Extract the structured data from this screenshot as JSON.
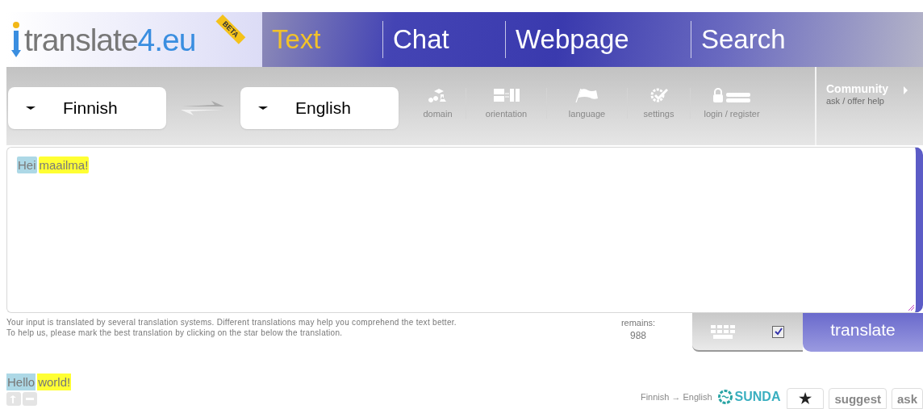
{
  "logo": {
    "parts": [
      "translate",
      "4.eu"
    ],
    "badge": "BETA"
  },
  "tabs": [
    {
      "label": "Text",
      "selected": true
    },
    {
      "label": "Chat",
      "selected": false
    },
    {
      "label": "Webpage",
      "selected": false
    },
    {
      "label": "Search",
      "selected": false
    }
  ],
  "languages": {
    "source": "Finnish",
    "target": "English"
  },
  "tools": [
    {
      "kind": "domain",
      "label": "domain"
    },
    {
      "kind": "orientation",
      "label": "orientation"
    },
    {
      "kind": "language",
      "label": "language"
    },
    {
      "kind": "settings",
      "label": "settings"
    },
    {
      "kind": "login",
      "label": "login / register"
    }
  ],
  "community": {
    "title": "Community",
    "subtitle": "ask / offer help"
  },
  "input": {
    "words": [
      {
        "text": "Hei",
        "color": "#add8e6"
      },
      {
        "text": "maailma!",
        "color": "#ffff33"
      }
    ]
  },
  "info": [
    "Your input is translated by several translation systems. Different translations may help you comprehend the text better.",
    "To help us, please mark the best translation by clicking on the star below the translation."
  ],
  "remains": {
    "label": "remains:",
    "value": "988"
  },
  "auto_translate": {
    "checked": true
  },
  "translate_button": "translate",
  "result": {
    "words": [
      {
        "text": "Hello",
        "color": "#add8e6"
      },
      {
        "text": "world!",
        "color": "#ffff33"
      }
    ],
    "direction": "Finnish → English",
    "engine": "SUNDA",
    "buttons": [
      {
        "kind": "star",
        "label": "★"
      },
      {
        "kind": "text",
        "label": "suggest"
      },
      {
        "kind": "text",
        "label": "ask"
      }
    ]
  }
}
